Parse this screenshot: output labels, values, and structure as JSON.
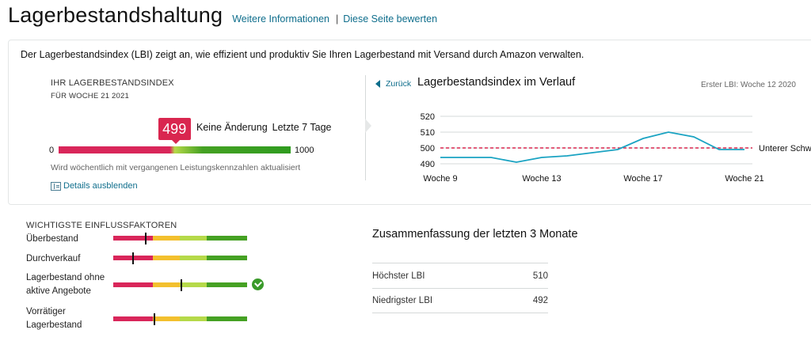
{
  "header": {
    "title": "Lagerbestandshaltung",
    "more_info": "Weitere Informationen",
    "separator": "|",
    "rate_page": "Diese Seite bewerten"
  },
  "intro": "Der Lagerbestandsindex (LBI) zeigt an, wie effizient und produktiv Sie Ihren Lagerbestand mit Versand durch Amazon verwalten.",
  "lbi": {
    "title": "IHR LAGERBESTANDSINDEX",
    "week": "FÜR WOCHE 21 2021",
    "value": "499",
    "value_fraction": 0.499,
    "change": "Keine Änderung",
    "period": "Letzte 7 Tage",
    "scale_min": "0",
    "scale_max": "1000",
    "note": "Wird wöchentlich mit vergangenen Leistungskennzahlen aktualisiert",
    "hide_details": "Details ausblenden"
  },
  "history": {
    "back": "Zurück",
    "title": "Lagerbestandsindex im Verlauf",
    "first_lbi": "Erster LBI: Woche 12 2020"
  },
  "chart_data": {
    "type": "line",
    "title": "Lagerbestandsindex im Verlauf",
    "x": [
      9,
      10,
      11,
      12,
      13,
      14,
      15,
      16,
      17,
      18,
      19,
      20,
      21
    ],
    "x_tick_labels": [
      "Woche 9",
      "Woche 13",
      "Woche 17",
      "Woche 21"
    ],
    "x_ticks": [
      9,
      13,
      17,
      21
    ],
    "y_ticks": [
      490,
      500,
      510,
      520
    ],
    "ylim": [
      486,
      522
    ],
    "series": [
      {
        "values": [
          494,
          494,
          494,
          491,
          494,
          495,
          497,
          499,
          506,
          510,
          507,
          499,
          499
        ],
        "color": "#1aa3c2"
      }
    ],
    "threshold": {
      "value": 500,
      "label": "Unterer Schw",
      "color": "#d9264f"
    },
    "grid": true
  },
  "factors": {
    "title": "WICHTIGSTE EINFLUSSFAKTOREN",
    "items": [
      {
        "label": "Überbestand",
        "marker": 0.24
      },
      {
        "label": "Durchverkauf",
        "marker": 0.15
      },
      {
        "label": "Lagerbestand ohne aktive Angebote",
        "marker": 0.51,
        "checked": true
      },
      {
        "label": "Vorrätiger Lagerbestand",
        "marker": 0.31
      }
    ]
  },
  "summary": {
    "title": "Zusammenfassung der letzten 3 Monate",
    "rows": [
      {
        "label": "Höchster LBI",
        "value": "510"
      },
      {
        "label": "Niedrigster LBI",
        "value": "492"
      }
    ]
  },
  "colors": {
    "link": "#0f6e8c",
    "badge": "#d9264f",
    "line": "#1aa3c2",
    "good": "#45a123"
  }
}
